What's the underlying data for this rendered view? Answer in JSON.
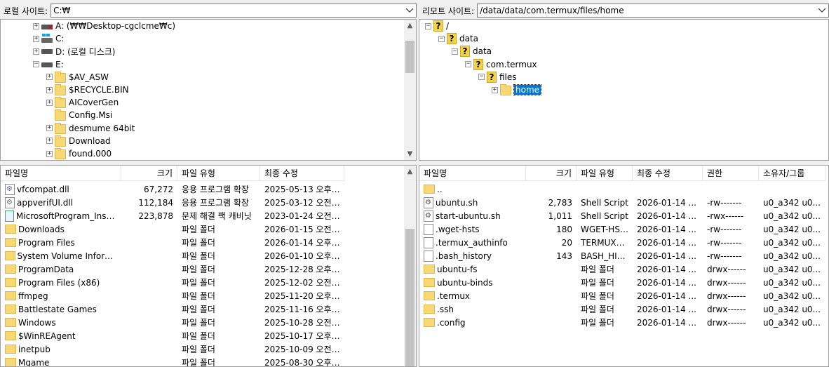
{
  "local": {
    "site_label": "로컬 사이트:",
    "path": "C:₩",
    "tree": [
      {
        "label": "A: (₩₩Desktop-cgclcme₩c)",
        "indent": 0,
        "icon": "network-drive-icon",
        "exp": "+"
      },
      {
        "label": "C:",
        "indent": 0,
        "icon": "windows-drive-icon",
        "exp": "+"
      },
      {
        "label": "D: (로컬 디스크)",
        "indent": 0,
        "icon": "drive-icon",
        "exp": "+"
      },
      {
        "label": "E:",
        "indent": 0,
        "icon": "drive-icon",
        "exp": "-"
      },
      {
        "label": "$AV_ASW",
        "indent": 1,
        "icon": "folder-icon",
        "exp": "+"
      },
      {
        "label": "$RECYCLE.BIN",
        "indent": 1,
        "icon": "folder-icon",
        "exp": "+"
      },
      {
        "label": "AICoverGen",
        "indent": 1,
        "icon": "folder-icon",
        "exp": "+"
      },
      {
        "label": "Config.Msi",
        "indent": 1,
        "icon": "folder-icon",
        "exp": ""
      },
      {
        "label": "desmume 64bit",
        "indent": 1,
        "icon": "folder-icon",
        "exp": "+"
      },
      {
        "label": "Download",
        "indent": 1,
        "icon": "folder-icon",
        "exp": "+"
      },
      {
        "label": "found.000",
        "indent": 1,
        "icon": "folder-icon",
        "exp": "+"
      }
    ],
    "columns": [
      "파일명",
      "크기",
      "파일 유형",
      "최종 수정"
    ],
    "files": [
      {
        "name": "vfcompat.dll",
        "size": "67,272",
        "type": "응용 프로그램 확장",
        "modified": "2025-05-13 오후 ...",
        "icon": "dll-icon"
      },
      {
        "name": "appverifUI.dll",
        "size": "112,184",
        "type": "응용 프로그램 확장",
        "modified": "2025-03-12 오전 ...",
        "icon": "dll-icon"
      },
      {
        "name": "MicrosoftProgram_Install...",
        "size": "223,878",
        "type": "문제 해결 팩 캐비닛",
        "modified": "2023-01-24 오전 ...",
        "icon": "cab-icon"
      },
      {
        "name": "Downloads",
        "size": "",
        "type": "파일 폴더",
        "modified": "2026-01-15 오전 ...",
        "icon": "folder-icon"
      },
      {
        "name": "Program Files",
        "size": "",
        "type": "파일 폴더",
        "modified": "2026-01-14 오후 ...",
        "icon": "folder-icon"
      },
      {
        "name": "System Volume Informat...",
        "size": "",
        "type": "파일 폴더",
        "modified": "2026-01-10 오후 ...",
        "icon": "folder-icon"
      },
      {
        "name": "ProgramData",
        "size": "",
        "type": "파일 폴더",
        "modified": "2025-12-28 오후 ...",
        "icon": "folder-icon"
      },
      {
        "name": "Program Files (x86)",
        "size": "",
        "type": "파일 폴더",
        "modified": "2025-12-02 오전 ...",
        "icon": "folder-icon"
      },
      {
        "name": "ffmpeg",
        "size": "",
        "type": "파일 폴더",
        "modified": "2025-11-20 오후 ...",
        "icon": "folder-icon"
      },
      {
        "name": "Battlestate Games",
        "size": "",
        "type": "파일 폴더",
        "modified": "2025-11-16 오후 ...",
        "icon": "folder-icon"
      },
      {
        "name": "Windows",
        "size": "",
        "type": "파일 폴더",
        "modified": "2025-10-28 오전 ...",
        "icon": "folder-icon"
      },
      {
        "name": "$WinREAgent",
        "size": "",
        "type": "파일 폴더",
        "modified": "2025-10-17 오후 ...",
        "icon": "folder-icon"
      },
      {
        "name": "inetpub",
        "size": "",
        "type": "파일 폴더",
        "modified": "2025-10-09 오전 ...",
        "icon": "folder-icon"
      },
      {
        "name": "Mgame",
        "size": "",
        "type": "파일 폴더",
        "modified": "2025-08-30 오후 ...",
        "icon": "folder-icon"
      }
    ]
  },
  "remote": {
    "site_label": "리모트 사이트:",
    "path": "/data/data/com.termux/files/home",
    "tree": [
      {
        "label": "/",
        "indent": 0,
        "icon": "unknown-icon",
        "exp": "-"
      },
      {
        "label": "data",
        "indent": 1,
        "icon": "unknown-icon",
        "exp": "-"
      },
      {
        "label": "data",
        "indent": 2,
        "icon": "unknown-icon",
        "exp": "-"
      },
      {
        "label": "com.termux",
        "indent": 3,
        "icon": "unknown-icon",
        "exp": "-"
      },
      {
        "label": "files",
        "indent": 4,
        "icon": "unknown-icon",
        "exp": "-"
      },
      {
        "label": "home",
        "indent": 5,
        "icon": "folder-icon",
        "exp": "+",
        "selected": true
      }
    ],
    "columns": [
      "파일명",
      "크기",
      "파일 유형",
      "최종 수정",
      "권한",
      "소유자/그룹"
    ],
    "files": [
      {
        "name": "..",
        "size": "",
        "type": "",
        "modified": "",
        "perm": "",
        "owner": "",
        "icon": "folder-icon"
      },
      {
        "name": "ubuntu.sh",
        "size": "2,783",
        "type": "Shell Script",
        "modified": "2026-01-14 ...",
        "perm": "-rw-------",
        "owner": "u0_a342 u0...",
        "icon": "script-icon"
      },
      {
        "name": "start-ubuntu.sh",
        "size": "1,011",
        "type": "Shell Script",
        "modified": "2026-01-14 ...",
        "perm": "-rwx------",
        "owner": "u0_a342 u0...",
        "icon": "script-icon"
      },
      {
        "name": ".wget-hsts",
        "size": "180",
        "type": "WGET-HST...",
        "modified": "2026-01-14 ...",
        "perm": "-rw-------",
        "owner": "u0_a342 u0...",
        "icon": "file-icon"
      },
      {
        "name": ".termux_authinfo",
        "size": "20",
        "type": "TERMUX_A...",
        "modified": "2026-01-14 ...",
        "perm": "-rw-------",
        "owner": "u0_a342 u0...",
        "icon": "file-icon"
      },
      {
        "name": ".bash_history",
        "size": "143",
        "type": "BASH_HIS...",
        "modified": "2026-01-14 ...",
        "perm": "-rw-------",
        "owner": "u0_a342 u0...",
        "icon": "file-icon"
      },
      {
        "name": "ubuntu-fs",
        "size": "",
        "type": "파일 폴더",
        "modified": "2026-01-14 ...",
        "perm": "drwx------",
        "owner": "u0_a342 u0...",
        "icon": "folder-icon"
      },
      {
        "name": "ubuntu-binds",
        "size": "",
        "type": "파일 폴더",
        "modified": "2026-01-14 ...",
        "perm": "drwx------",
        "owner": "u0_a342 u0...",
        "icon": "folder-icon"
      },
      {
        "name": ".termux",
        "size": "",
        "type": "파일 폴더",
        "modified": "2026-01-14 ...",
        "perm": "drwx------",
        "owner": "u0_a342 u0...",
        "icon": "folder-icon"
      },
      {
        "name": ".ssh",
        "size": "",
        "type": "파일 폴더",
        "modified": "2026-01-14 ...",
        "perm": "drwx------",
        "owner": "u0_a342 u0...",
        "icon": "folder-icon"
      },
      {
        "name": ".config",
        "size": "",
        "type": "파일 폴더",
        "modified": "2026-01-14 ...",
        "perm": "drwx------",
        "owner": "u0_a342 u0...",
        "icon": "folder-icon"
      }
    ]
  }
}
